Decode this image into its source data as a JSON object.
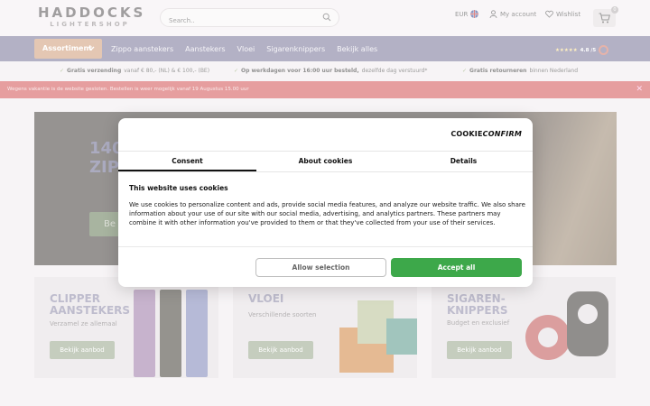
{
  "header": {
    "logo_main": "HADDOCKS",
    "logo_sub": "LIGHTERSHOP",
    "search_placeholder": "Search..",
    "currency": "EUR",
    "account": "My account",
    "wishlist": "Wishlist",
    "cart_count": "0"
  },
  "nav": {
    "assortment": "Assortiment",
    "items": [
      "Zippo aanstekers",
      "Aanstekers",
      "Vloei",
      "Sigarenknippers",
      "Bekijk alles"
    ],
    "rating": "4.8 /5",
    "stars": "★★★★★"
  },
  "usps": [
    {
      "bold": "Gratis verzending",
      "rest": "vanaf € 80,- (NL) & € 100,- (BE)"
    },
    {
      "bold": "Op werkdagen voor 16:00 uur besteld,",
      "rest": "dezelfde dag verstuurd*"
    },
    {
      "bold": "Gratis retourneren",
      "rest": "binnen Nederland"
    }
  ],
  "notice": {
    "text": "Wegens vakantie is de website gesloten. Bestellen is weer mogelijk vanaf 19 Augustus 15.00 uur",
    "close": "✕"
  },
  "hero": {
    "title_line1": "140",
    "title_line2": "ZIP",
    "button": "Be"
  },
  "cards": [
    {
      "title1": "CLIPPER",
      "title2": "AANSTEKERS",
      "sub": "Verzamel ze allemaal",
      "button": "Bekijk aanbod"
    },
    {
      "title1": "VLOEI",
      "title2": "",
      "sub": "Verschillende soorten",
      "button": "Bekijk aanbod"
    },
    {
      "title1": "SIGAREN-",
      "title2": "KNIPPERS",
      "sub": "Budget en exclusief",
      "button": "Bekijk aanbod"
    }
  ],
  "cookie": {
    "brand_a": "COOKIE",
    "brand_b": "CONFIRM",
    "tabs": [
      "Consent",
      "About cookies",
      "Details"
    ],
    "title": "This website uses cookies",
    "body": "We use cookies to personalize content and ads, provide social media features, and analyze our website traffic. We also share information about your use of our site with our social media, advertising, and analytics partners. These partners may combine it with other information you've provided to them or that they've collected from your use of their services.",
    "allow_selection": "Allow selection",
    "accept_all": "Accept all"
  },
  "colors": {
    "nav": "#8a87a6",
    "accent": "#d6a98a",
    "notice": "#d96a6c",
    "accept": "#3da84a"
  }
}
